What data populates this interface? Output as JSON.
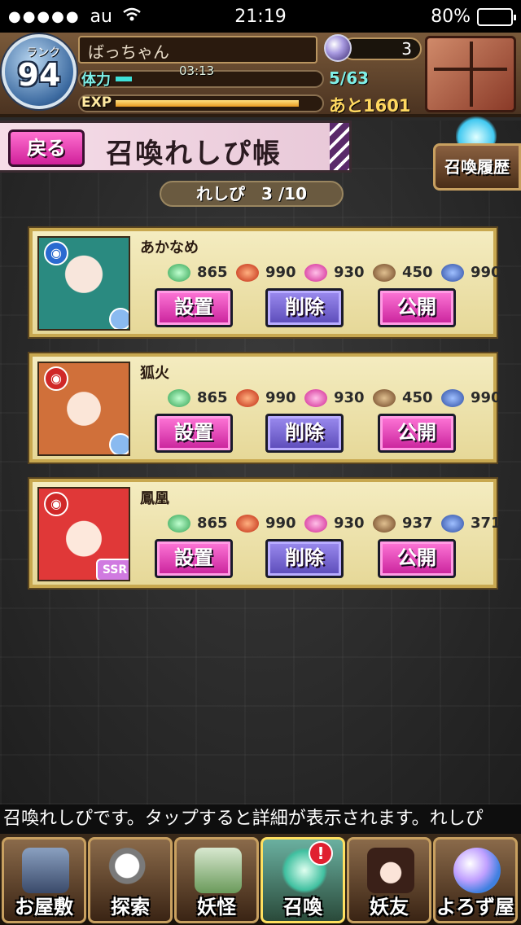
{
  "status_bar": {
    "dots": "●●●●●",
    "carrier": "au",
    "wifi": "wifi-icon",
    "time": "21:19",
    "battery": "80%",
    "battery_level": 0.8
  },
  "player": {
    "rank_label": "ランク",
    "rank": "94",
    "name": "ばっちゃん",
    "stones": "3",
    "stamina_label": "体力",
    "stamina_timer": "03:13",
    "stamina": "5/63",
    "stamina_fraction": 0.08,
    "exp_label": "EXP",
    "exp_remaining": "あと1601",
    "exp_fraction": 0.9
  },
  "header": {
    "back_label": "戻る",
    "title": "召喚れしぴ帳",
    "history_label": "召喚履歴"
  },
  "recipe_count": "れしぴ　3 /10",
  "resource_icons": [
    "green-stone-icon",
    "red-leaf-icon",
    "pink-cloth-icon",
    "brown-pouch-icon",
    "blue-grapes-icon"
  ],
  "recipes": [
    {
      "name": "あかなめ",
      "element": "water",
      "values": [
        "865",
        "990",
        "930",
        "450",
        "990"
      ],
      "buttons": {
        "set": "設置",
        "delete": "削除",
        "publish": "公開"
      }
    },
    {
      "name": "狐火",
      "element": "fire",
      "values": [
        "865",
        "990",
        "930",
        "450",
        "990"
      ],
      "buttons": {
        "set": "設置",
        "delete": "削除",
        "publish": "公開"
      }
    },
    {
      "name": "鳳凰",
      "element": "fire",
      "badge": "SSR",
      "values": [
        "865",
        "990",
        "930",
        "937",
        "371"
      ],
      "buttons": {
        "set": "設置",
        "delete": "削除",
        "publish": "公開"
      }
    }
  ],
  "ticker": "召喚れしぴです。タップすると詳細が表示されます。れしぴ",
  "nav": [
    {
      "label": "お屋敷",
      "icon": "mansion-icon"
    },
    {
      "label": "探索",
      "icon": "magnifier-icon"
    },
    {
      "label": "妖怪",
      "icon": "youkai-scroll-icon"
    },
    {
      "label": "召喚",
      "icon": "summon-star-icon",
      "alert": "!"
    },
    {
      "label": "妖友",
      "icon": "friend-girl-icon"
    },
    {
      "label": "よろず屋",
      "icon": "shop-orb-icon"
    }
  ]
}
